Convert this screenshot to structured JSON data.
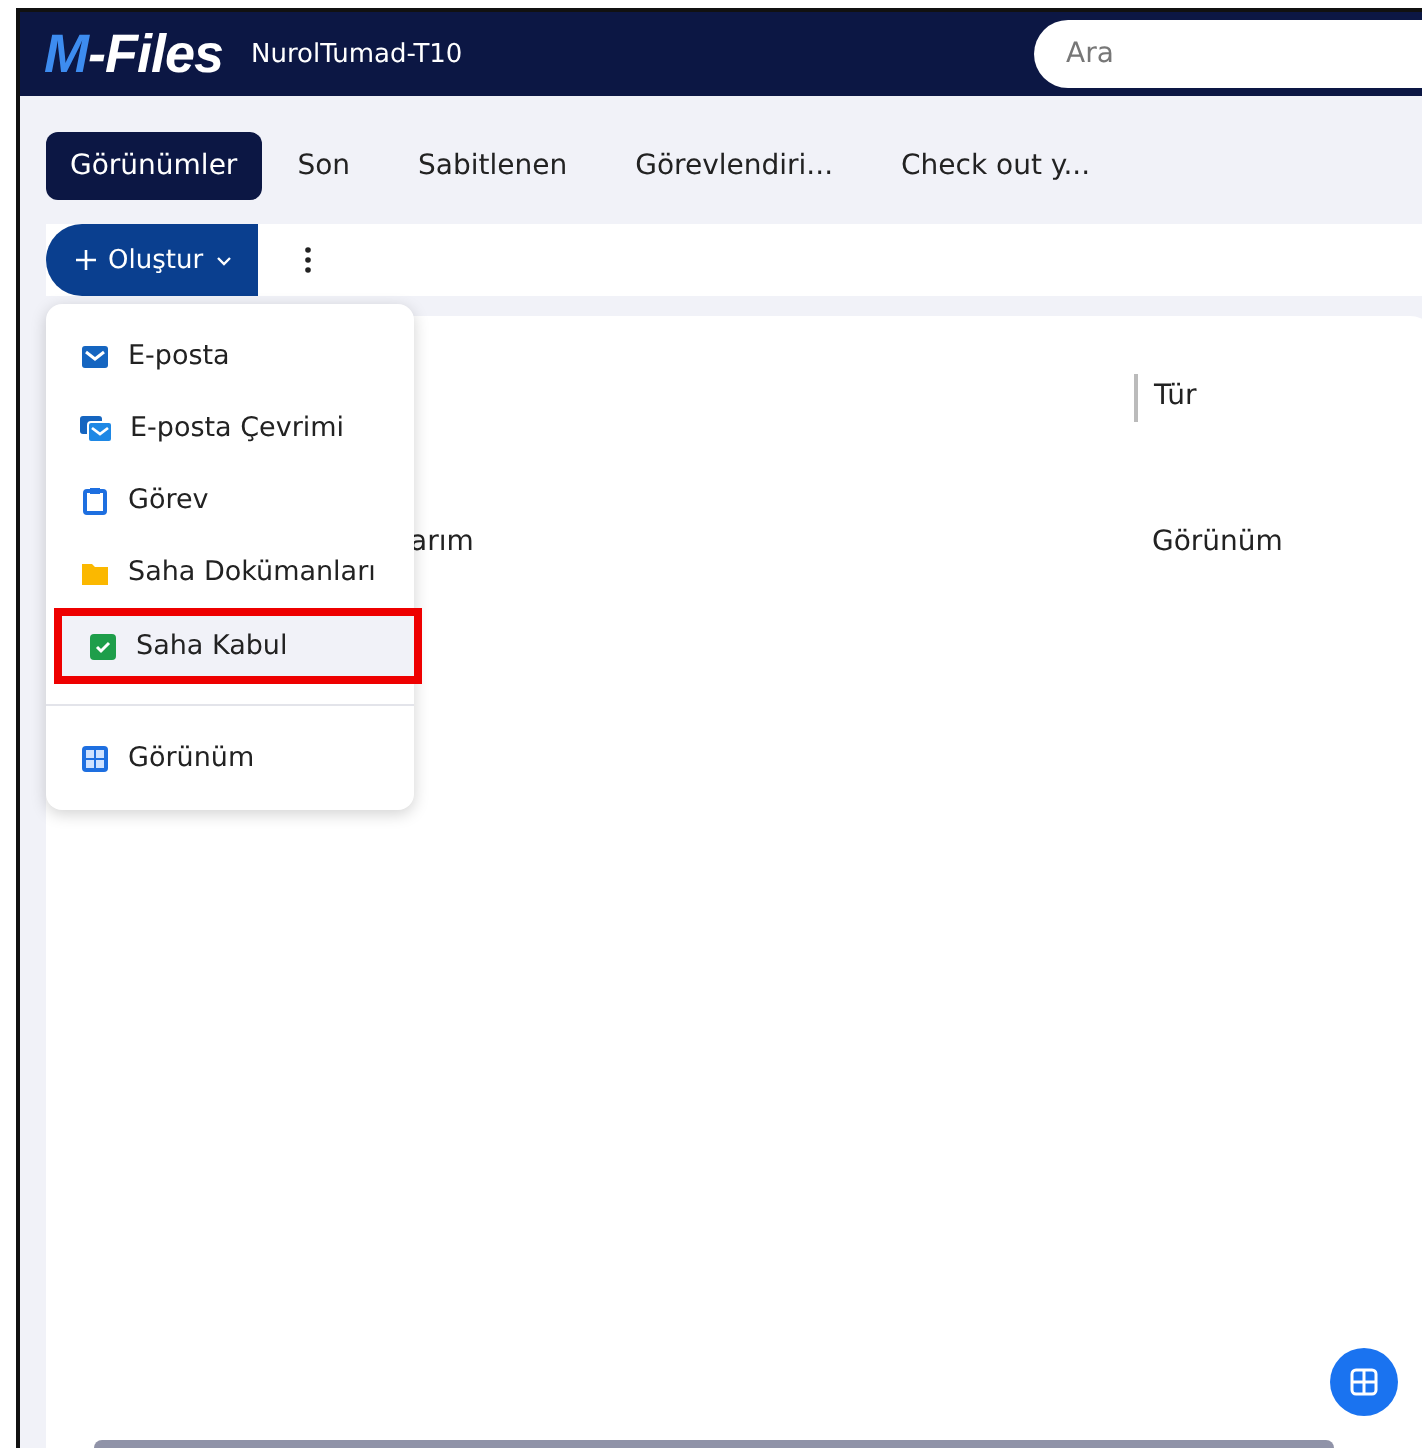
{
  "header": {
    "logo": {
      "mark": "M",
      "rest": "-Files"
    },
    "vault": "NurolTumad-T10",
    "search": {
      "placeholder": "Ara"
    }
  },
  "tabs": [
    {
      "label": "Görünümler",
      "selected": true
    },
    {
      "label": "Son",
      "selected": false
    },
    {
      "label": "Sabitlenen",
      "selected": false
    },
    {
      "label": "Görevlendiri...",
      "selected": false
    },
    {
      "label": "Check out y...",
      "selected": false
    }
  ],
  "toolbar": {
    "create_button": {
      "label": "Oluştur",
      "expanded": true
    }
  },
  "table": {
    "columns": [
      {
        "label": "Tür"
      }
    ],
    "rows": [
      {
        "name": "arım",
        "type": "Görünüm"
      }
    ]
  },
  "create_menu": {
    "items": [
      {
        "label": "E-posta",
        "kind": "mail",
        "highlighted": false
      },
      {
        "label": "E-posta Çevrimi",
        "kind": "mails",
        "highlighted": false
      },
      {
        "label": "Görev",
        "kind": "task",
        "highlighted": false
      },
      {
        "label": "Saha Dokümanları",
        "kind": "folder",
        "highlighted": false
      },
      {
        "label": "Saha Kabul",
        "kind": "check",
        "highlighted": true
      },
      {
        "label": "Görünüm",
        "kind": "view",
        "highlighted": false,
        "separated": true
      }
    ]
  }
}
